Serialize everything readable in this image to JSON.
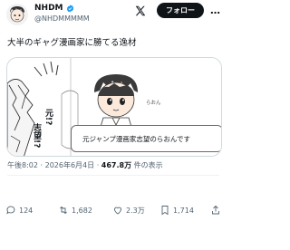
{
  "author": {
    "name": "NHDM",
    "handle": "@NHDMMMMM",
    "follow_label": "フォロー"
  },
  "tweet": {
    "text": "大半のギャグ漫画家に勝てる逸材"
  },
  "image": {
    "caption": "元ジャンプ漫画家志望のらおんです",
    "character_name": "らおん",
    "manga_line_1": "元!?",
    "manga_line_2": "志望!?"
  },
  "meta": {
    "time": "午後8:02",
    "date": "2026年6月4日",
    "views": "467.8万",
    "views_label": "件の表示"
  },
  "actions": {
    "replies": "124",
    "reposts": "1,682",
    "likes": "2.3万",
    "bookmarks": "1,714"
  },
  "colors": {
    "text": "#0f1419",
    "muted": "#536471",
    "verified": "#1d9bf0",
    "button": "#0f1419"
  }
}
